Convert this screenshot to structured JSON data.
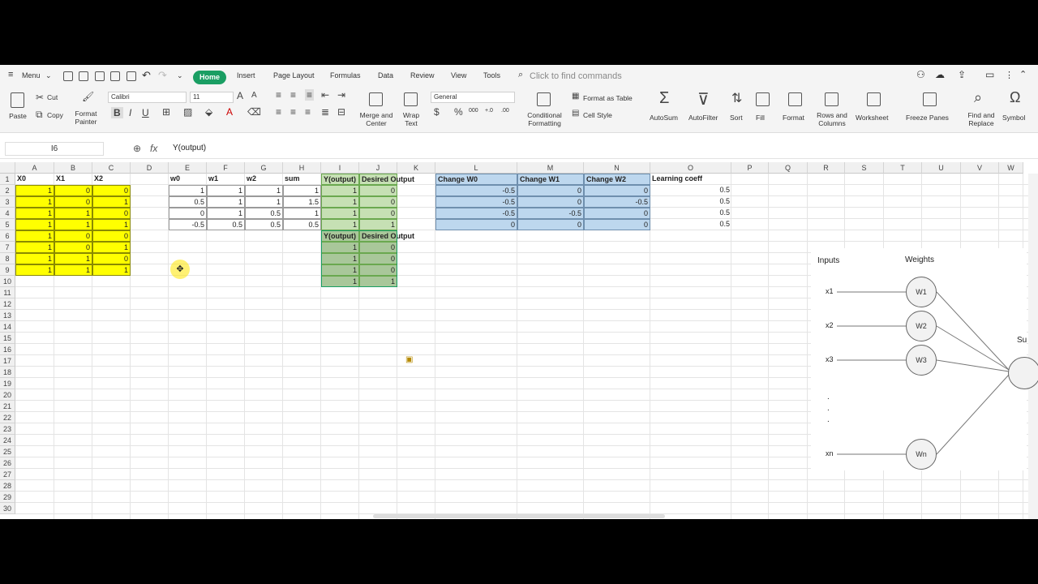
{
  "menubar": {
    "menu_label": "Menu",
    "tabs": [
      "Home",
      "Insert",
      "Page Layout",
      "Formulas",
      "Data",
      "Review",
      "View",
      "Tools"
    ],
    "search_placeholder": "Click to find commands"
  },
  "ribbon": {
    "paste": "Paste",
    "cut": "Cut",
    "copy": "Copy",
    "format_painter": "Format\nPainter",
    "font_name": "Calibri",
    "font_size": "11",
    "merge_center": "Merge and\nCenter",
    "wrap_text": "Wrap\nText",
    "number_format": "General",
    "conditional_formatting": "Conditional\nFormatting",
    "format_as_table": "Format as Table",
    "cell_style": "Cell Style",
    "autosum": "AutoSum",
    "autofilter": "AutoFilter",
    "sort": "Sort",
    "fill": "Fill",
    "format": "Format",
    "rows_columns": "Rows and\nColumns",
    "worksheet": "Worksheet",
    "freeze_panes": "Freeze Panes",
    "find_replace": "Find and\nReplace",
    "symbol": "Symbol"
  },
  "formula_bar": {
    "name_box": "I6",
    "fx": "fx",
    "formula": "Y(output)"
  },
  "columns": [
    "A",
    "B",
    "C",
    "D",
    "E",
    "F",
    "G",
    "H",
    "I",
    "J",
    "K",
    "L",
    "M",
    "N",
    "O",
    "P",
    "Q",
    "R",
    "S",
    "T",
    "U",
    "V",
    "W"
  ],
  "rows": [
    "1",
    "2",
    "3",
    "4",
    "5",
    "6",
    "7",
    "8",
    "9",
    "10",
    "11",
    "12",
    "13",
    "14",
    "15",
    "16",
    "17",
    "18",
    "19",
    "20",
    "21",
    "22",
    "23",
    "24",
    "25",
    "26",
    "27",
    "28",
    "29",
    "30"
  ],
  "headers": {
    "x0": "X0",
    "x1": "X1",
    "x2": "X2",
    "w0": "w0",
    "w1": "w1",
    "w2": "w2",
    "sum": "sum",
    "y_output": "Y(output)",
    "desired": "Desired Output",
    "chg_w0": "Change W0",
    "chg_w1": "Change W1",
    "chg_w2": "Change W2",
    "learning": "Learning coeff",
    "y_output2": "Y(output)",
    "desired2": "Desired Output"
  },
  "inputs": [
    [
      "1",
      "0",
      "0"
    ],
    [
      "1",
      "0",
      "1"
    ],
    [
      "1",
      "1",
      "0"
    ],
    [
      "1",
      "1",
      "1"
    ],
    [
      "1",
      "0",
      "0"
    ],
    [
      "1",
      "0",
      "1"
    ],
    [
      "1",
      "1",
      "0"
    ],
    [
      "1",
      "1",
      "1"
    ]
  ],
  "weights": [
    [
      "1",
      "1",
      "1",
      "1",
      "1",
      "0"
    ],
    [
      "0.5",
      "1",
      "1",
      "1.5",
      "1",
      "0"
    ],
    [
      "0",
      "1",
      "0.5",
      "1",
      "1",
      "0"
    ],
    [
      "-0.5",
      "0.5",
      "0.5",
      "0.5",
      "1",
      "1"
    ]
  ],
  "changes": [
    [
      "-0.5",
      "0",
      "0",
      "0.5"
    ],
    [
      "-0.5",
      "0",
      "-0.5",
      "0.5"
    ],
    [
      "-0.5",
      "-0.5",
      "0",
      "0.5"
    ],
    [
      "0",
      "0",
      "0",
      "0.5"
    ]
  ],
  "output2": [
    [
      "1",
      "0"
    ],
    [
      "1",
      "0"
    ],
    [
      "1",
      "0"
    ],
    [
      "1",
      "1"
    ]
  ],
  "diagram": {
    "inputs_label": "Inputs",
    "weights_label": "Weights",
    "x_labels": [
      "x1",
      "x2",
      "x3",
      "xn"
    ],
    "w_labels": [
      "W1",
      "W2",
      "W3",
      "Wn"
    ],
    "sum_label": "Su",
    "dots": "."
  }
}
